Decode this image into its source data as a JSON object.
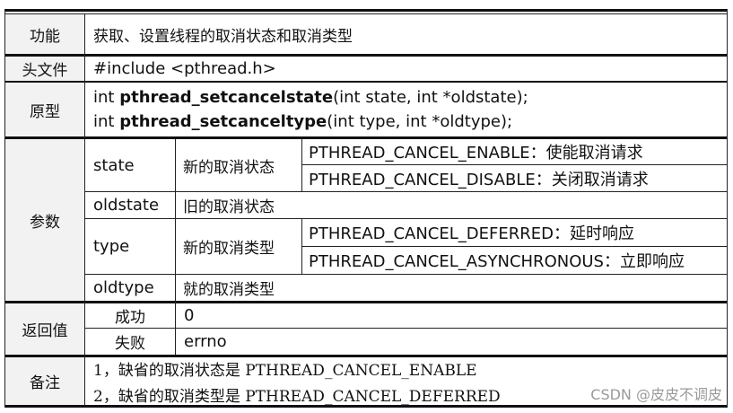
{
  "table": {
    "func": {
      "label": "功能",
      "value": "获取、设置线程的取消状态和取消类型"
    },
    "header": {
      "label": "头文件",
      "value": "#include <pthread.h>"
    },
    "proto": {
      "label": "原型",
      "line1": {
        "pre": "int ",
        "name": "pthread_setcancelstate",
        "args": "(int state, int *oldstate);"
      },
      "line2": {
        "pre": "int ",
        "name": "pthread_setcanceltype",
        "args": "(int type, int *oldtype);"
      }
    },
    "params": {
      "label": "参数",
      "state": {
        "name": "state",
        "desc": "新的取消状态",
        "options": [
          "PTHREAD_CANCEL_ENABLE：使能取消请求",
          "PTHREAD_CANCEL_DISABLE：关闭取消请求"
        ]
      },
      "oldstate": {
        "name": "oldstate",
        "desc": "旧的取消状态"
      },
      "type": {
        "name": "type",
        "desc": "新的取消类型",
        "options": [
          "PTHREAD_CANCEL_DEFERRED：延时响应",
          "PTHREAD_CANCEL_ASYNCHRONOUS：立即响应"
        ]
      },
      "oldtype": {
        "name": "oldtype",
        "desc": "就的取消类型"
      }
    },
    "ret": {
      "label": "返回值",
      "success": {
        "label": "成功",
        "value": "0"
      },
      "failure": {
        "label": "失败",
        "value": "errno"
      }
    },
    "notes": {
      "label": "备注",
      "lines": [
        "1，缺省的取消状态是 PTHREAD_CANCEL_ENABLE",
        "2，缺省的取消类型是 PTHREAD_CANCEL_DEFERRED"
      ]
    }
  },
  "watermark": "CSDN @皮皮不调皮"
}
